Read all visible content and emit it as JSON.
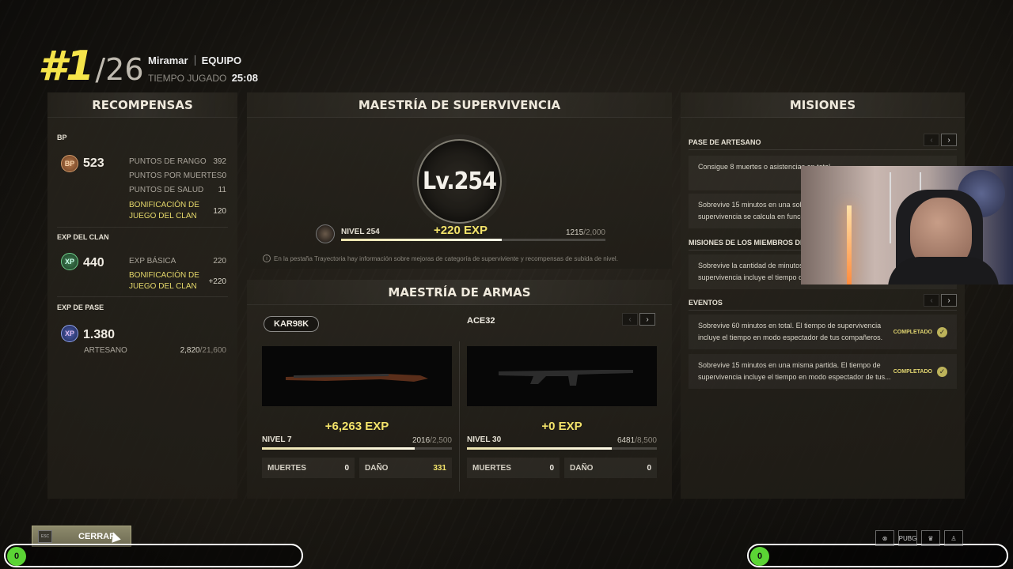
{
  "header": {
    "rank": "#1",
    "total": "/26",
    "map": "Miramar",
    "mode": "EQUIPO",
    "time_label": "TIEMPO JUGADO",
    "time_value": "25:08"
  },
  "rewards": {
    "title": "RECOMPENSAS",
    "bp": {
      "label": "BP",
      "icon": "BP",
      "total": "523",
      "rows": [
        {
          "label": "PUNTOS DE RANGO",
          "value": "392"
        },
        {
          "label": "PUNTOS POR MUERTES",
          "value": "0"
        },
        {
          "label": "PUNTOS DE SALUD",
          "value": "11"
        },
        {
          "label": "BONIFICACIÓN DE JUEGO DEL CLAN",
          "value": "120"
        }
      ]
    },
    "clan_exp": {
      "label": "EXP DEL CLAN",
      "icon": "XP",
      "total": "440",
      "rows": [
        {
          "label": "EXP BÁSICA",
          "value": "220"
        },
        {
          "label": "BONIFICACIÓN DE JUEGO DEL CLAN",
          "value": "+220"
        }
      ]
    },
    "pass_exp": {
      "label": "EXP DE PASE",
      "icon": "XP",
      "total": "1.380",
      "tier": "ARTESANO",
      "progress": "2,820",
      "progress_max": "/21,600"
    }
  },
  "survival": {
    "title": "MAESTRÍA DE SUPERVIVENCIA",
    "level_display": "Lv.254",
    "level_label": "NIVEL 254",
    "exp_gain": "+220 EXP",
    "progress": "1215",
    "progress_max": "/2,000",
    "progress_fraction": 0.6075,
    "note": "En la pestaña Trayectoria hay información sobre mejoras de categoría de superviviente y recompensas de subida de nivel."
  },
  "weapons": {
    "title": "MAESTRÍA DE ARMAS",
    "items": [
      {
        "name": "KAR98K",
        "exp_gain": "+6,263 EXP",
        "level": "NIVEL 7",
        "progress": "2016",
        "progress_max": "/2,500",
        "progress_fraction": 0.806,
        "kills_label": "MUERTES",
        "kills": "0",
        "damage_label": "DAÑO",
        "damage": "331"
      },
      {
        "name": "ACE32",
        "exp_gain": "+0 EXP",
        "level": "NIVEL 30",
        "progress": "6481",
        "progress_max": "/8,500",
        "progress_fraction": 0.762,
        "kills_label": "MUERTES",
        "kills": "0",
        "damage_label": "DAÑO",
        "damage": "0"
      }
    ]
  },
  "missions": {
    "title": "MISIONES",
    "sections": [
      {
        "label": "PASE DE ARTESANO",
        "items": [
          "Consigue 8 muertes o asistencias en total.",
          "Sobrevive 15 minutos en una sola partida. El tiempo de supervivencia se calcula en función..."
        ]
      },
      {
        "label": "MISIONES DE LOS MIEMBROS DEL CLAN",
        "items": [
          "Sobrevive la cantidad de minutos requerida. El tiempo de supervivencia incluye el tiempo que..."
        ]
      },
      {
        "label": "EVENTOS",
        "items": [
          {
            "text": "Sobrevive 60 minutos en total. El tiempo de supervivencia incluye el tiempo en modo espectador de tus compañeros.",
            "status": "COMPLETADO"
          },
          {
            "text": "Sobrevive 15 minutos en una misma partida. El tiempo de supervivencia incluye el tiempo en modo espectador de tus...",
            "status": "COMPLETADO"
          }
        ]
      }
    ]
  },
  "footer": {
    "esc_label": "ESC",
    "close_label": "CERRAR",
    "left_counter": "0",
    "right_counter": "0",
    "icons": [
      "crosshair-icon",
      "pubg-icon",
      "clan-icon",
      "profile-icon"
    ],
    "icon_labels": [
      "⊗",
      "PUBG",
      "♛",
      "♙"
    ]
  },
  "colors": {
    "accent_yellow": "#f3e36a",
    "counter_green": "#5bd435"
  }
}
